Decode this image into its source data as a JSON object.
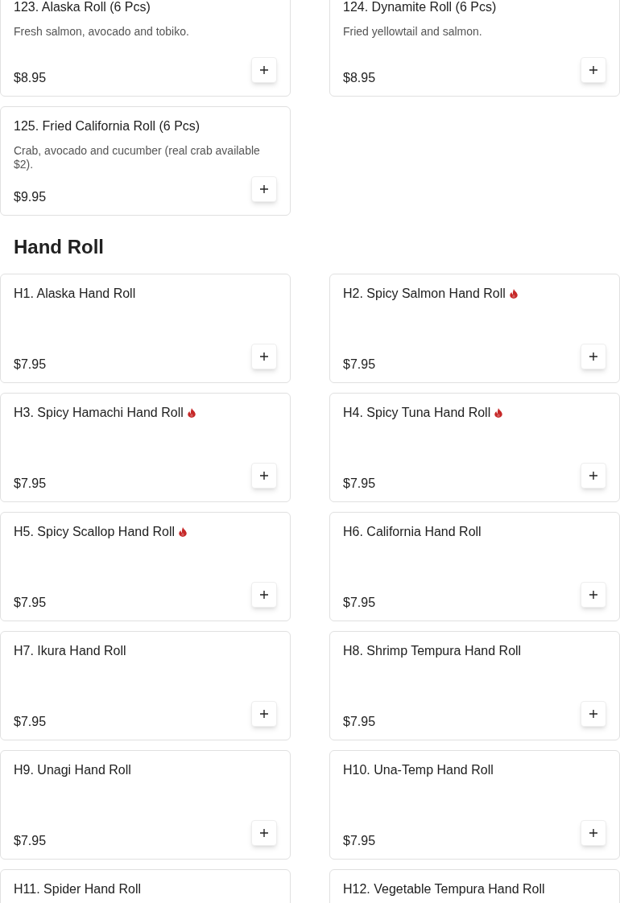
{
  "sections": [
    {
      "items": [
        {
          "title": "123. Alaska Roll (6 Pcs)",
          "spicy": false,
          "description": "Fresh salmon, avocado and tobiko.",
          "price": "$8.95"
        },
        {
          "title": "124. Dynamite Roll (6 Pcs)",
          "spicy": false,
          "description": "Fried yellowtail and salmon.",
          "price": "$8.95"
        },
        {
          "title": "125. Fried California Roll (6 Pcs)",
          "spicy": false,
          "description": "Crab, avocado and cucumber (real crab available $2).",
          "price": "$9.95"
        }
      ]
    },
    {
      "heading": "Hand Roll",
      "items": [
        {
          "title": "H1. Alaska Hand Roll",
          "spicy": false,
          "price": "$7.95"
        },
        {
          "title": "H2. Spicy Salmon Hand Roll",
          "spicy": true,
          "price": "$7.95"
        },
        {
          "title": "H3. Spicy Hamachi Hand Roll",
          "spicy": true,
          "price": "$7.95"
        },
        {
          "title": "H4. Spicy Tuna Hand Roll",
          "spicy": true,
          "price": "$7.95"
        },
        {
          "title": "H5. Spicy Scallop Hand Roll",
          "spicy": true,
          "price": "$7.95"
        },
        {
          "title": "H6. California Hand Roll",
          "spicy": false,
          "price": "$7.95"
        },
        {
          "title": "H7. Ikura Hand Roll",
          "spicy": false,
          "price": "$7.95"
        },
        {
          "title": "H8. Shrimp Tempura Hand Roll",
          "spicy": false,
          "price": "$7.95"
        },
        {
          "title": "H9. Unagi Hand Roll",
          "spicy": false,
          "price": "$7.95"
        },
        {
          "title": "H10. Una-Temp Hand Roll",
          "spicy": false,
          "price": "$7.95"
        },
        {
          "title": "H11. Spider Hand Roll",
          "spicy": false
        },
        {
          "title": "H12. Vegetable Tempura Hand Roll",
          "spicy": false
        }
      ]
    }
  ]
}
